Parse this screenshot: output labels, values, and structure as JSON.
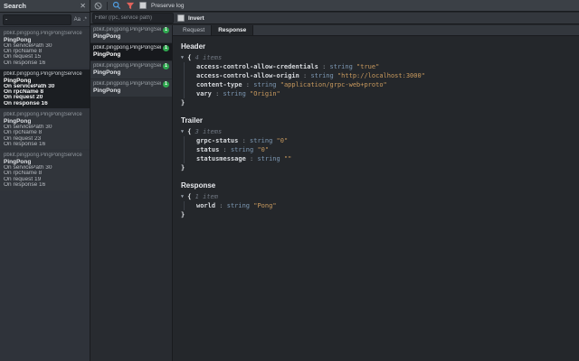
{
  "search_panel": {
    "title": "Search",
    "query": "-",
    "match_case_label": "Aa",
    "regex_label": ".*",
    "results": [
      {
        "service": "pbkit.pingpong.PingPongService",
        "method": "PingPong",
        "details": [
          "On servicePath 30",
          "On rpcName 8",
          "On request 15",
          "On response 16"
        ]
      },
      {
        "service": "pbkit.pingpong.PingPongService",
        "method": "PingPong",
        "details": [
          "On servicePath 30",
          "On rpcName 8",
          "On request 20",
          "On response 16"
        ]
      },
      {
        "service": "pbkit.pingpong.PingPongService",
        "method": "PingPong",
        "details": [
          "On servicePath 30",
          "On rpcName 8",
          "On request 23",
          "On response 16"
        ]
      },
      {
        "service": "pbkit.pingpong.PingPongService",
        "method": "PingPong",
        "details": [
          "On servicePath 30",
          "On rpcName 8",
          "On request 19",
          "On response 16"
        ]
      }
    ]
  },
  "toolbar": {
    "preserve_log_label": "Preserve log"
  },
  "filter_bar": {
    "placeholder": "Filter (rpc, service path)",
    "invert_label": "Invert"
  },
  "call_list": {
    "items": [
      {
        "service": "pbkit.pingpong.PingPongService",
        "method": "PingPong",
        "badge": "1"
      },
      {
        "service": "pbkit.pingpong.PingPongService",
        "method": "PingPong",
        "badge": "1"
      },
      {
        "service": "pbkit.pingpong.PingPongService",
        "method": "PingPong",
        "badge": "1"
      },
      {
        "service": "pbkit.pingpong.PingPongService",
        "method": "PingPong",
        "badge": "1"
      }
    ]
  },
  "detail": {
    "tabs": [
      {
        "label": "Request"
      },
      {
        "label": "Response"
      }
    ],
    "sections": [
      {
        "title": "Header",
        "count": "4 items",
        "entries": [
          {
            "key": "access-control-allow-credentials",
            "type": "string",
            "value": "\"true\""
          },
          {
            "key": "access-control-allow-origin",
            "type": "string",
            "value": "\"http://localhost:3000\""
          },
          {
            "key": "content-type",
            "type": "string",
            "value": "\"application/grpc-web+proto\""
          },
          {
            "key": "vary",
            "type": "string",
            "value": "\"Origin\""
          }
        ]
      },
      {
        "title": "Trailer",
        "count": "3 items",
        "entries": [
          {
            "key": "grpc-status",
            "type": "string",
            "value": "\"0\""
          },
          {
            "key": "status",
            "type": "string",
            "value": "\"0\""
          },
          {
            "key": "statusmessage",
            "type": "string",
            "value": "\"\""
          }
        ]
      },
      {
        "title": "Response",
        "count": "1 item",
        "entries": [
          {
            "key": "world",
            "type": "string",
            "value": "\"Pong\""
          }
        ]
      }
    ]
  },
  "colors": {
    "accent_search": "#509de0",
    "accent_filter": "#e0635c",
    "badge_green": "#2fa84f",
    "json_key": "#d6d9dd",
    "json_type": "#7d98b3",
    "json_value": "#c99a5e"
  }
}
